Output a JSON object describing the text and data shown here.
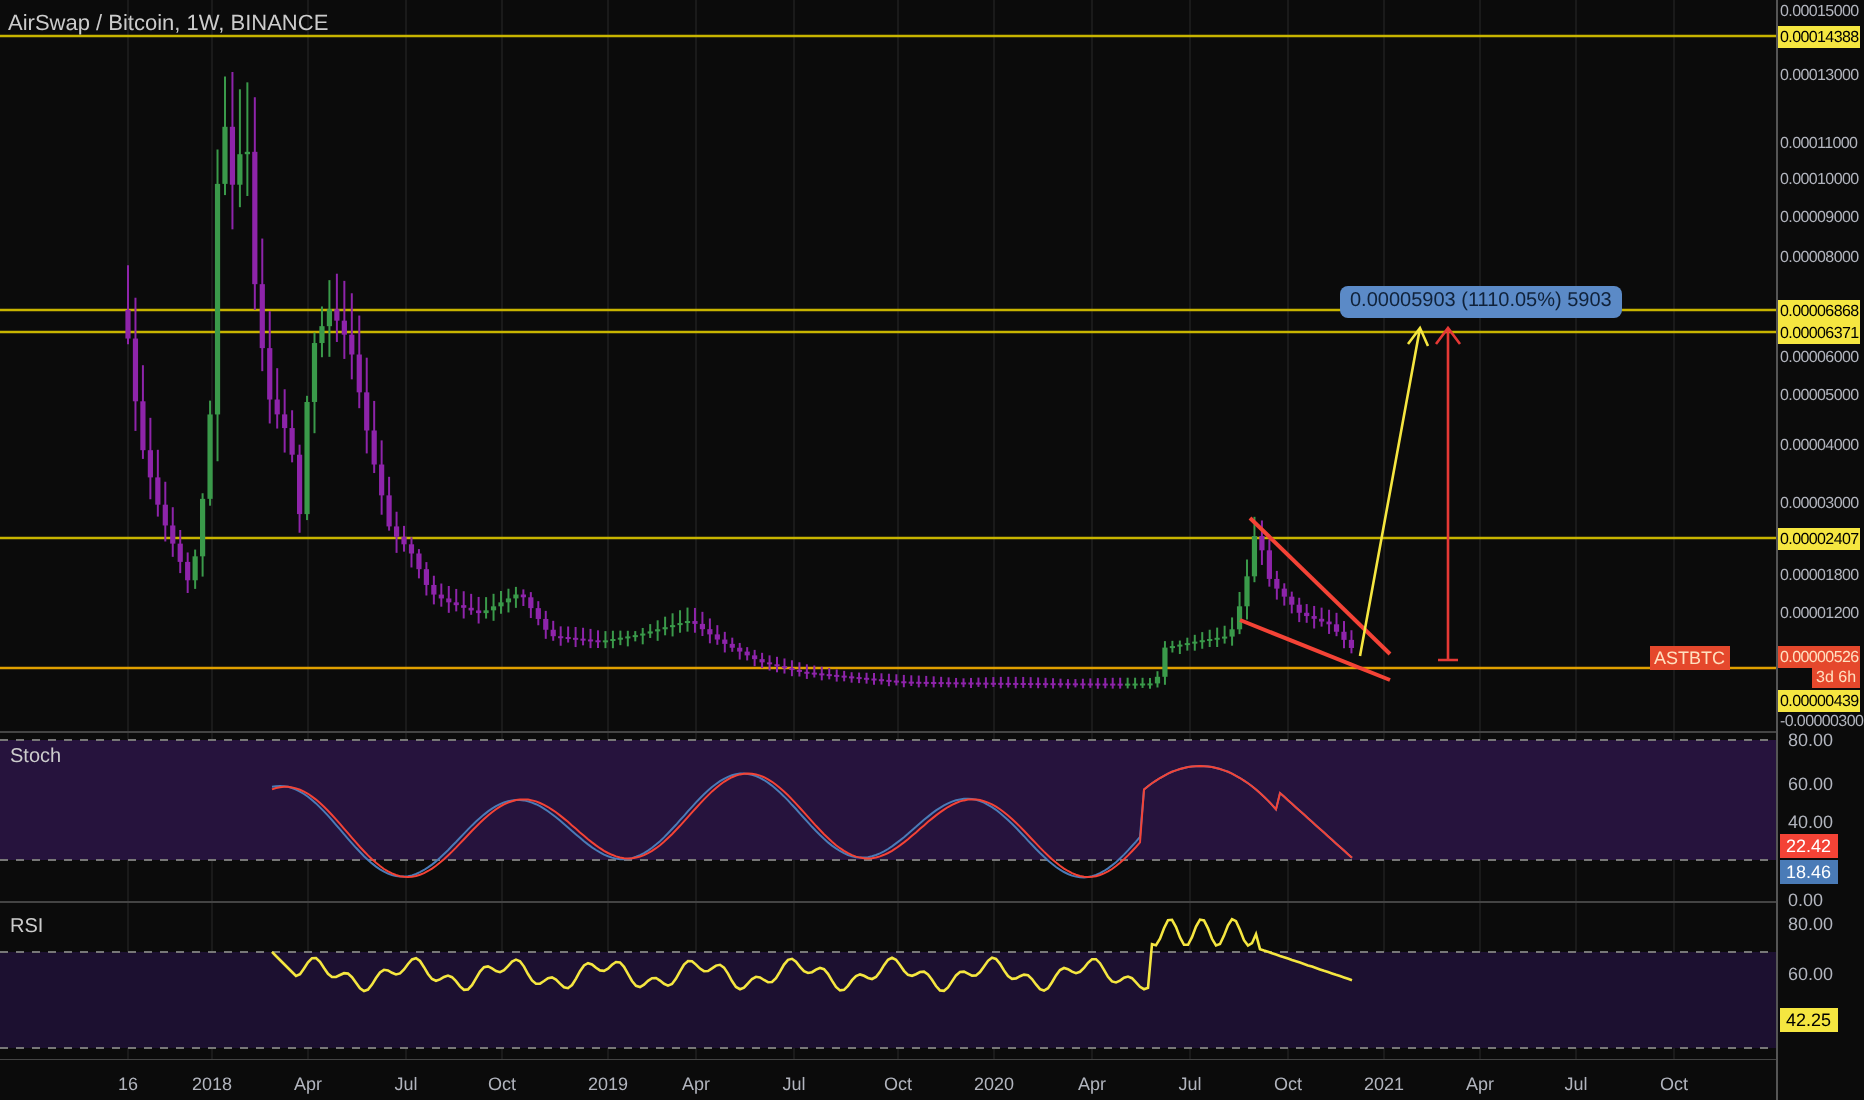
{
  "chart_title": "AirSwap / Bitcoin, 1W, BINANCE",
  "price_axis": {
    "ticks": [
      "0.00015000",
      "0.00013000",
      "0.00011000",
      "0.00010000",
      "0.00009000",
      "0.00008000",
      "0.00006000",
      "0.00005000",
      "0.00004000",
      "0.00003000",
      "0.00001800",
      "0.00001200",
      "-0.00000300"
    ],
    "levels": [
      {
        "label": "0.00014388"
      },
      {
        "label": "0.00006868"
      },
      {
        "label": "0.00006371"
      },
      {
        "label": "0.00002407"
      },
      {
        "label": "0.00000439"
      }
    ],
    "last_price": {
      "symbol": "ASTBTC",
      "value": "0.00000526",
      "countdown": "3d 6h"
    }
  },
  "measure_label": "0.00005903 (1110.05%) 5903",
  "stoch": {
    "title": "Stoch",
    "ticks": [
      "80.00",
      "60.00",
      "40.00",
      "0.00"
    ],
    "values": [
      {
        "label": "22.42",
        "color": "#f44336"
      },
      {
        "label": "18.46",
        "color": "#4a7bb7"
      }
    ]
  },
  "rsi": {
    "title": "RSI",
    "ticks": [
      "80.00",
      "60.00"
    ],
    "value": "42.25"
  },
  "time_axis": [
    "16",
    "2018",
    "Apr",
    "Jul",
    "Oct",
    "2019",
    "Apr",
    "Jul",
    "Oct",
    "2020",
    "Apr",
    "Jul",
    "Oct",
    "2021",
    "Apr",
    "Jul",
    "Oct"
  ]
}
